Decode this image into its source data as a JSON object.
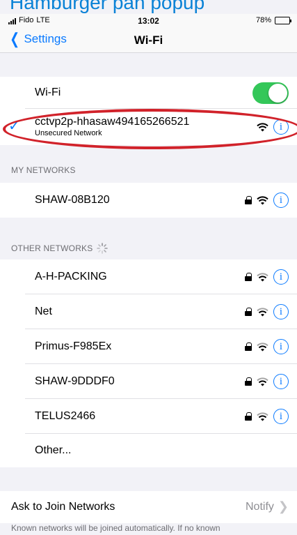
{
  "banner": {
    "text": "Hamburger pan popup"
  },
  "status_bar": {
    "carrier": "Fido",
    "network": "LTE",
    "time": "13:02",
    "battery": "78%",
    "battery_level": 0.78
  },
  "nav": {
    "back_label": "Settings",
    "title": "Wi-Fi"
  },
  "wifi": {
    "toggle_label": "Wi-Fi",
    "enabled": true
  },
  "connected": {
    "name": "cctvp2p-hhasaw494165266521",
    "status": "Unsecured Network"
  },
  "my_networks": {
    "header": "MY NETWORKS",
    "items": [
      {
        "name": "SHAW-08B120",
        "secured": true
      }
    ]
  },
  "other_networks": {
    "header": "OTHER NETWORKS",
    "items": [
      {
        "name": "A-H-PACKING",
        "secured": true
      },
      {
        "name": "Net",
        "secured": true
      },
      {
        "name": "Primus-F985Ex",
        "secured": true
      },
      {
        "name": "SHAW-9DDDF0",
        "secured": true
      },
      {
        "name": "TELUS2466",
        "secured": true
      }
    ],
    "other_label": "Other..."
  },
  "ask_to_join": {
    "label": "Ask to Join Networks",
    "value": "Notify"
  },
  "footer": {
    "text": "Known networks will be joined automatically. If no known"
  },
  "colors": {
    "accent": "#0a7aff",
    "toggle_on": "#34c759",
    "annotation": "#d1222a"
  }
}
